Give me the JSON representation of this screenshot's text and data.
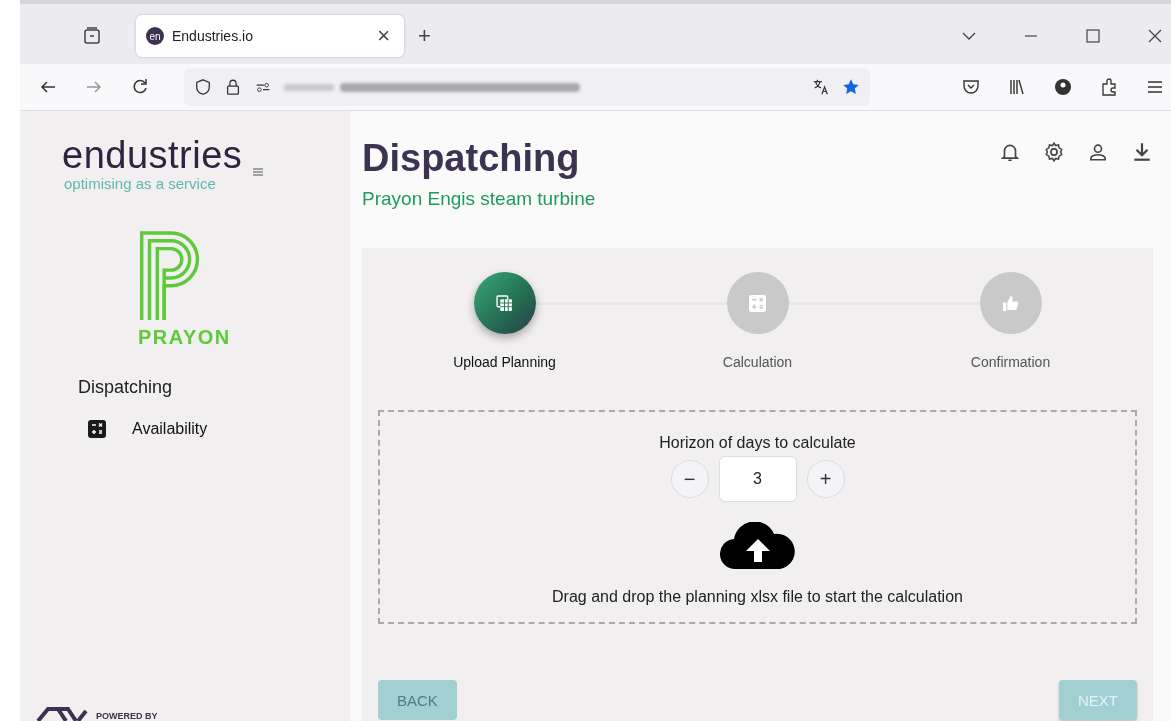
{
  "browser": {
    "tab_icon": "en",
    "tab_title": "Endustries.io",
    "close": "×",
    "new_tab": "+"
  },
  "sidebar": {
    "logo": "endustries",
    "tagline": "optimising as a service",
    "client": "PRAYON",
    "section": "Dispatching",
    "items": [
      {
        "label": "Availability",
        "kind": "calculator"
      }
    ],
    "footer": "POWERED BY"
  },
  "header": {
    "title": "Dispatching",
    "subtitle": "Prayon Engis steam turbine"
  },
  "steps": [
    {
      "label": "Upload Planning",
      "kind": "upload",
      "selected": true
    },
    {
      "label": "Calculation",
      "kind": "calculator",
      "selected": false
    },
    {
      "label": "Confirmation",
      "kind": "thumb",
      "selected": false
    }
  ],
  "upload": {
    "label": "Horizon of days to calculate",
    "decrement": "−",
    "value": "3",
    "increment": "+",
    "hint": "Drag and drop the planning xlsx file to start the calculation"
  },
  "buttons": [
    {
      "label": "BACK",
      "disabled": true
    },
    {
      "label": "NEXT",
      "disabled": true
    }
  ]
}
